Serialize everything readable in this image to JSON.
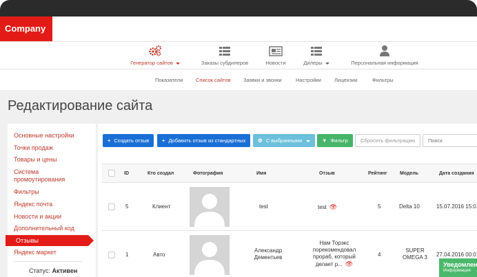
{
  "brand": {
    "logo": "Company",
    "accent": "#e31b17"
  },
  "main_nav": [
    {
      "label": "Генератор сайтов",
      "icon": "gears-icon",
      "active": true,
      "has_caret": true
    },
    {
      "label": "Заказы субдилеров",
      "icon": "list-icon",
      "active": false
    },
    {
      "label": "Новости",
      "icon": "newspaper-icon",
      "active": false
    },
    {
      "label": "Дилеры",
      "icon": "list-icon",
      "active": false,
      "has_caret": true
    },
    {
      "label": "Персональная информация",
      "icon": "user-icon",
      "active": false
    }
  ],
  "sub_nav": [
    {
      "label": "Показатели",
      "active": false
    },
    {
      "label": "Список сайтов",
      "active": true
    },
    {
      "label": "Заявки и звонки",
      "active": false
    },
    {
      "label": "Настройки",
      "active": false
    },
    {
      "label": "Лицензии",
      "active": false
    },
    {
      "label": "Фильтры",
      "active": false
    }
  ],
  "page_title": "Редактирование сайта",
  "sidebar": {
    "items": [
      {
        "label": "Основные настройки",
        "active": false
      },
      {
        "label": "Точки продаж",
        "active": false
      },
      {
        "label": "Товары и цены",
        "active": false
      },
      {
        "label": "Система промоутирования",
        "active": false
      },
      {
        "label": "Фильтры",
        "active": false
      },
      {
        "label": "Яндекс почта",
        "active": false
      },
      {
        "label": "Новости и акции",
        "active": false
      },
      {
        "label": "Дополнительный код",
        "active": false
      },
      {
        "label": "Отзывы",
        "active": true
      },
      {
        "label": "Яндекс маркет",
        "active": false
      }
    ],
    "status_label": "Статус:",
    "status_value": "Активен"
  },
  "toolbar": {
    "create": "Создать отзыв",
    "add_standard": "Добавить отзыв из стандартных",
    "with_selected": "С выбранными",
    "filter": "Фильтр",
    "reset_filter": "Сбросить фильтрацию",
    "search_placeholder": "Поиск"
  },
  "table": {
    "columns": [
      "ID",
      "Кто создал",
      "Фотография",
      "Имя",
      "Отзыв",
      "Рейтинг",
      "Модель",
      "Дата создания"
    ],
    "rows": [
      {
        "id": "5",
        "created_by": "Клиент",
        "name": "test",
        "review": "test",
        "rating": "5",
        "model": "Delta 10",
        "date": "15.07.2016 15:0"
      },
      {
        "id": "1",
        "created_by": "Авто",
        "name": "Александр Дементьев",
        "review": "Нам Торэкс порекомендовал прораб, который делает р...",
        "rating": "4",
        "model": "SUPER OMEGA 3",
        "date": "27.04.2016 00:0"
      }
    ]
  },
  "toast": {
    "title": "Уведомлен",
    "subtitle": "Информация"
  }
}
